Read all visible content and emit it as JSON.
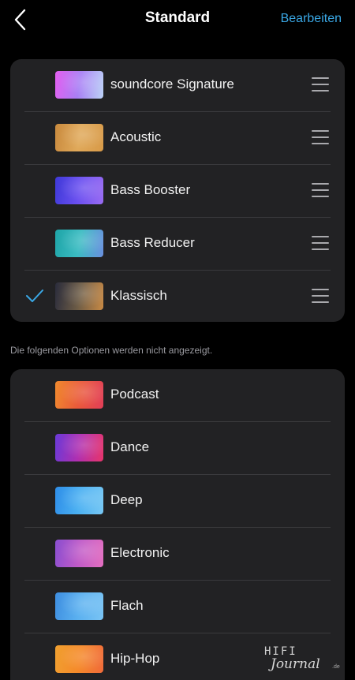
{
  "header": {
    "title": "Standard",
    "edit_label": "Bearbeiten"
  },
  "shown_presets": [
    {
      "label": "soundcore Signature",
      "colors": [
        "#e45ff0",
        "#a87ff5",
        "#bcd4f7"
      ],
      "selected": false
    },
    {
      "label": "Acoustic",
      "colors": [
        "#c98a3e",
        "#e0a95a",
        "#d89a48"
      ],
      "selected": false
    },
    {
      "label": "Bass Booster",
      "colors": [
        "#3f3ad8",
        "#6a4ff0",
        "#9a6cf2"
      ],
      "selected": false
    },
    {
      "label": "Bass Reducer",
      "colors": [
        "#1fa5a8",
        "#3bbcc2",
        "#6b8fe0"
      ],
      "selected": false
    },
    {
      "label": "Klassisch",
      "colors": [
        "#2a2c3c",
        "#6d5c46",
        "#c98a45"
      ],
      "selected": true
    }
  ],
  "note": "Die folgenden Optionen werden nicht angezeigt.",
  "hidden_presets": [
    {
      "label": "Podcast",
      "colors": [
        "#f08a2e",
        "#ea5a3a",
        "#e23e58"
      ]
    },
    {
      "label": "Dance",
      "colors": [
        "#6a3ad8",
        "#b02fb0",
        "#e8356a"
      ]
    },
    {
      "label": "Deep",
      "colors": [
        "#2f8ee8",
        "#4ab0f2",
        "#78c8f4"
      ]
    },
    {
      "label": "Electronic",
      "colors": [
        "#8a4fd0",
        "#c05ac8",
        "#e46fc0"
      ]
    },
    {
      "label": "Flach",
      "colors": [
        "#3e8ee0",
        "#5ab0f0",
        "#7ac4f4"
      ]
    },
    {
      "label": "Hip-Hop",
      "colors": [
        "#f0a030",
        "#f58a2a",
        "#f06a3a"
      ]
    }
  ],
  "watermark": {
    "line1": "HIFI",
    "line2": "Journal",
    "suffix": ".de"
  },
  "colors": {
    "accent": "#3aa8e6",
    "card": "#222224",
    "background": "#000000"
  }
}
